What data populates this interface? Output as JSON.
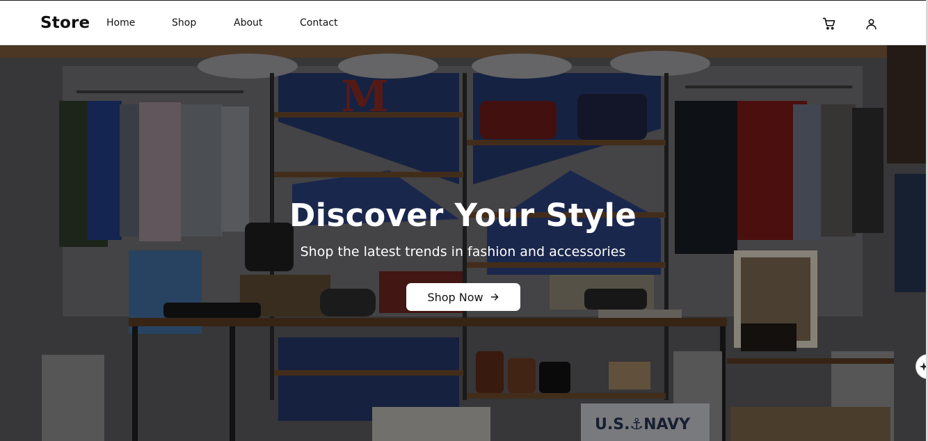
{
  "brand": {
    "name": "Store"
  },
  "nav": {
    "items": [
      {
        "label": "Home"
      },
      {
        "label": "Shop"
      },
      {
        "label": "About"
      },
      {
        "label": "Contact"
      }
    ],
    "icons": [
      "cart-icon",
      "user-icon"
    ]
  },
  "hero": {
    "title": "Discover Your Style",
    "subtitle": "Shop the latest trends in fashion and accessories",
    "cta_label": "Shop Now",
    "cta_icon": "arrow-right-icon",
    "background_image": "store-interior-photo",
    "overlay_color": "#000000"
  },
  "side_widget": {
    "icon": "sparkle-icon"
  },
  "colors": {
    "nav_bg": "#ffffff",
    "text": "#111111",
    "hero_text": "#ffffff",
    "button_bg": "#ffffff"
  }
}
